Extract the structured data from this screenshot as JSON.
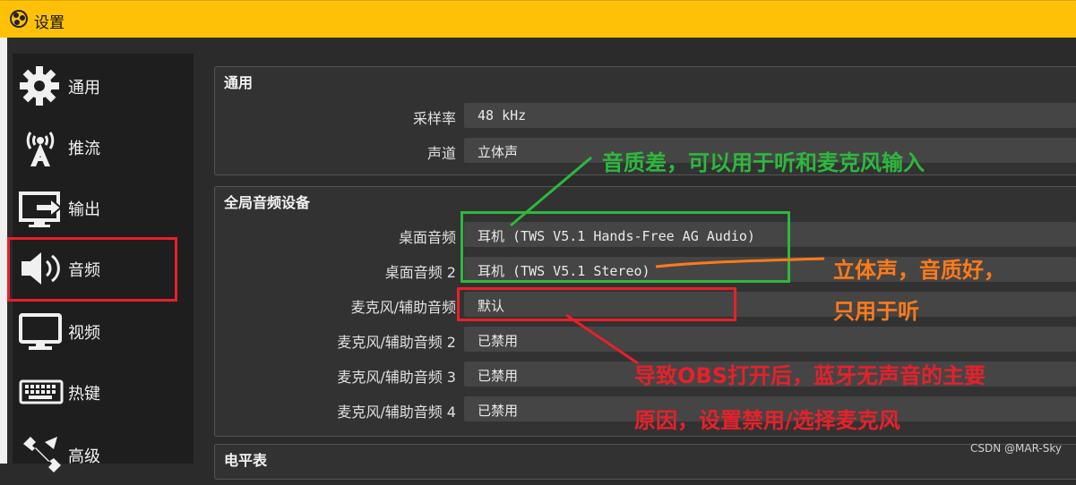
{
  "window": {
    "title": "设置"
  },
  "sidebar": {
    "items": [
      {
        "label": "通用",
        "icon": "gear-icon"
      },
      {
        "label": "推流",
        "icon": "broadcast-tower-icon"
      },
      {
        "label": "输出",
        "icon": "output-monitor-icon"
      },
      {
        "label": "音频",
        "icon": "speaker-icon",
        "selected": true
      },
      {
        "label": "视频",
        "icon": "monitor-icon"
      },
      {
        "label": "热键",
        "icon": "keyboard-icon"
      },
      {
        "label": "高级",
        "icon": "wrench-icon"
      }
    ]
  },
  "general": {
    "title": "通用",
    "sample_rate_label": "采样率",
    "sample_rate_value": "48 kHz",
    "channels_label": "声道",
    "channels_value": "立体声"
  },
  "global_audio": {
    "title": "全局音频设备",
    "rows": [
      {
        "label": "桌面音频",
        "value": "耳机 (TWS V5.1 Hands-Free AG Audio)"
      },
      {
        "label": "桌面音频 2",
        "value": "耳机 (TWS V5.1 Stereo)"
      },
      {
        "label": "麦克风/辅助音频",
        "value": "默认"
      },
      {
        "label": "麦克风/辅助音频 2",
        "value": "已禁用"
      },
      {
        "label": "麦克风/辅助音频 3",
        "value": "已禁用"
      },
      {
        "label": "麦克风/辅助音频 4",
        "value": "已禁用"
      }
    ]
  },
  "meters": {
    "title": "电平表"
  },
  "annotations": {
    "green_note": "音质差，可以用于听和麦克风输入",
    "orange_note_line1": "立体声，音质好，",
    "orange_note_line2": "只用于听",
    "red_note_line1": "导致OBS打开后，蓝牙无声音的主要",
    "red_note_line2": "原因，设置禁用/选择麦克风"
  },
  "colors": {
    "titlebar": "#ffc107",
    "green_annotation": "#2db83d",
    "orange_annotation": "#ff7a1a",
    "red_annotation": "#e8202a"
  },
  "watermark": "CSDN @MAR-Sky"
}
